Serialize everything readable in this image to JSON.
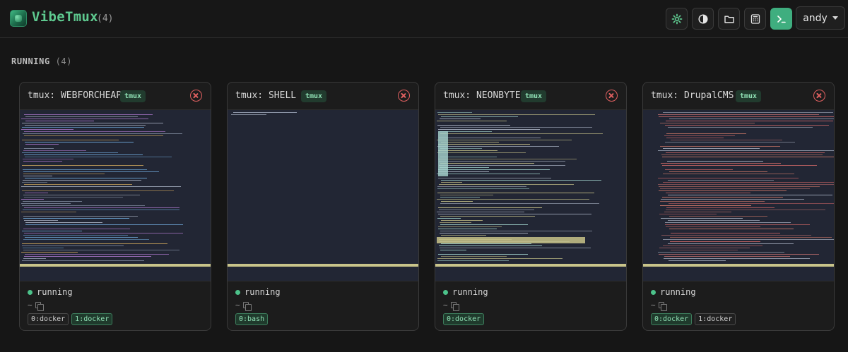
{
  "app": {
    "title": "VibeTmux",
    "count": "(4)",
    "user": "andy"
  },
  "toolbar": [
    {
      "name": "settings-icon",
      "accent": false
    },
    {
      "name": "theme-toggle-icon",
      "accent": false
    },
    {
      "name": "folder-icon",
      "accent": false
    },
    {
      "name": "calculator-icon",
      "accent": false
    },
    {
      "name": "terminal-icon",
      "accent": true
    }
  ],
  "section": {
    "label": "RUNNING",
    "count": "(4)"
  },
  "sessions": [
    {
      "name": "tmux: WEBFORCHEAP",
      "tag": "tmux",
      "status": "running",
      "path": "~",
      "windows": [
        {
          "label": "0:docker",
          "active": false
        },
        {
          "label": "1:docker",
          "active": true
        }
      ]
    },
    {
      "name": "tmux: SHELL",
      "tag": "tmux",
      "status": "running",
      "path": "~",
      "windows": [
        {
          "label": "0:bash",
          "active": true
        }
      ]
    },
    {
      "name": "tmux: NEONBYTE",
      "tag": "tmux",
      "status": "running",
      "path": "~",
      "windows": [
        {
          "label": "0:docker",
          "active": true
        }
      ]
    },
    {
      "name": "tmux: DrupalCMS",
      "tag": "tmux",
      "status": "running",
      "path": "~",
      "windows": [
        {
          "label": "0:docker",
          "active": true
        },
        {
          "label": "1:docker",
          "active": false
        }
      ]
    }
  ],
  "colors": {
    "accent": "#3fae7f",
    "brand": "#5ec98f",
    "danger": "#e06060",
    "terminal_bg": "#222634"
  }
}
